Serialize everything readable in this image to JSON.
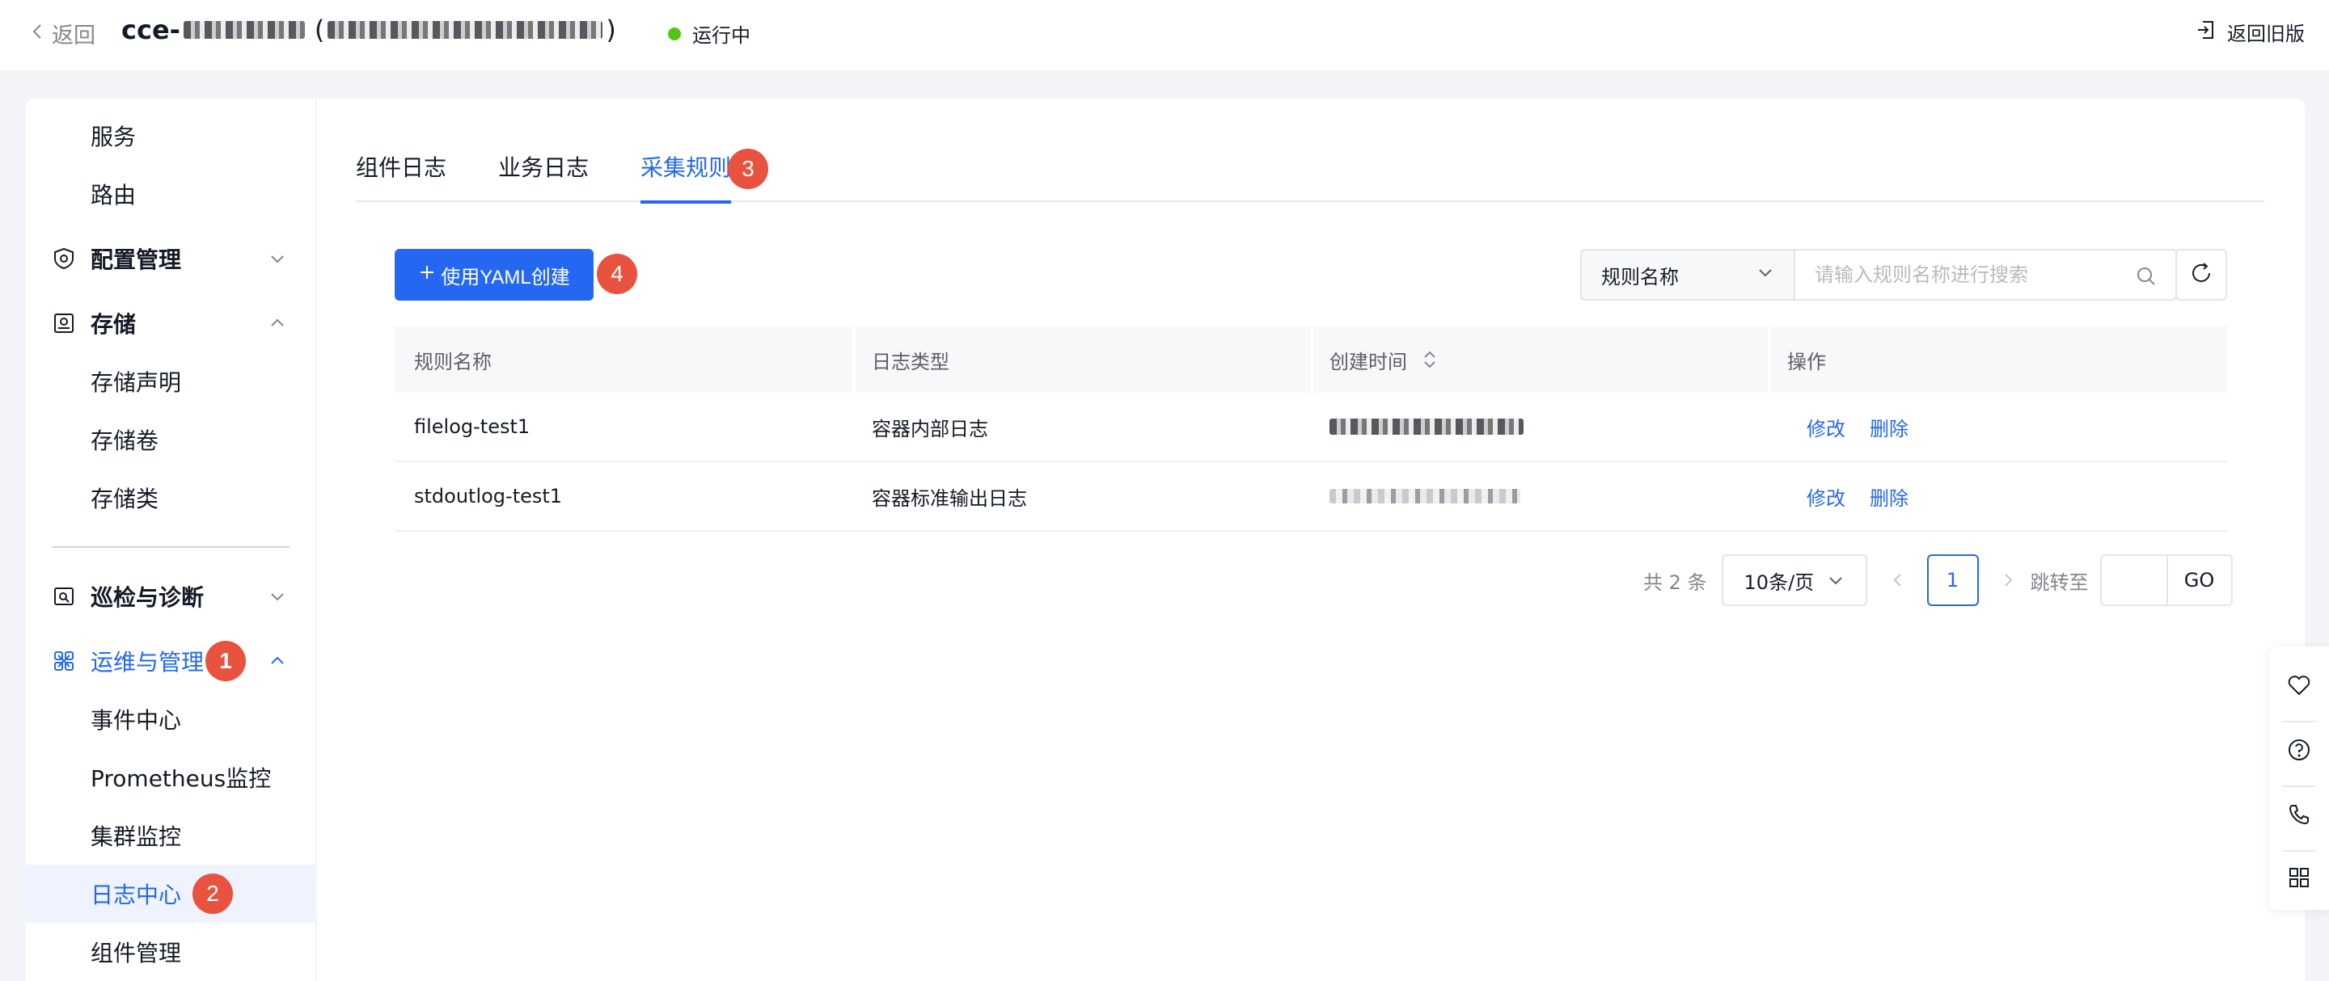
{
  "topbar": {
    "back_label": "返回",
    "cluster_prefix": "cce-",
    "status_text": "运行中",
    "old_version_label": "返回旧版"
  },
  "sidebar": {
    "items": [
      {
        "label": "服务",
        "type": "sub"
      },
      {
        "label": "路由",
        "type": "sub"
      },
      {
        "label": "配置管理",
        "type": "group",
        "icon": "config-icon",
        "expanded": false
      },
      {
        "label": "存储",
        "type": "group",
        "icon": "storage-icon",
        "expanded": true
      },
      {
        "label": "存储声明",
        "type": "sub"
      },
      {
        "label": "存储卷",
        "type": "sub"
      },
      {
        "label": "存储类",
        "type": "sub"
      },
      {
        "label": "巡检与诊断",
        "type": "group",
        "icon": "inspection-icon",
        "expanded": false
      },
      {
        "label": "运维与管理",
        "type": "group",
        "icon": "ops-icon",
        "expanded": true,
        "active": true,
        "badge": "1"
      },
      {
        "label": "事件中心",
        "type": "sub"
      },
      {
        "label": "Prometheus监控",
        "type": "sub"
      },
      {
        "label": "集群监控",
        "type": "sub"
      },
      {
        "label": "日志中心",
        "type": "sub",
        "selected": true,
        "badge": "2"
      },
      {
        "label": "组件管理",
        "type": "sub"
      }
    ]
  },
  "tabs": [
    {
      "label": "组件日志"
    },
    {
      "label": "业务日志"
    },
    {
      "label": "采集规则",
      "active": true,
      "badge": "3"
    }
  ],
  "toolbar": {
    "create_label": "使用YAML创建",
    "create_badge": "4",
    "select_value": "规则名称",
    "search_placeholder": "请输入规则名称进行搜索"
  },
  "table": {
    "headers": [
      "规则名称",
      "日志类型",
      "创建时间",
      "操作"
    ],
    "rows": [
      {
        "name": "filelog-test1",
        "type": "容器内部日志",
        "actions": [
          "修改",
          "删除"
        ]
      },
      {
        "name": "stdoutlog-test1",
        "type": "容器标准输出日志",
        "actions": [
          "修改",
          "删除"
        ]
      }
    ]
  },
  "pagination": {
    "total_text": "共 2 条",
    "page_size": "10条/页",
    "current_page": "1",
    "jump_label": "跳转至",
    "go_label": "GO"
  },
  "colors": {
    "accent": "#2468f2",
    "badge": "#e8523f",
    "status_running": "#52c41a"
  }
}
